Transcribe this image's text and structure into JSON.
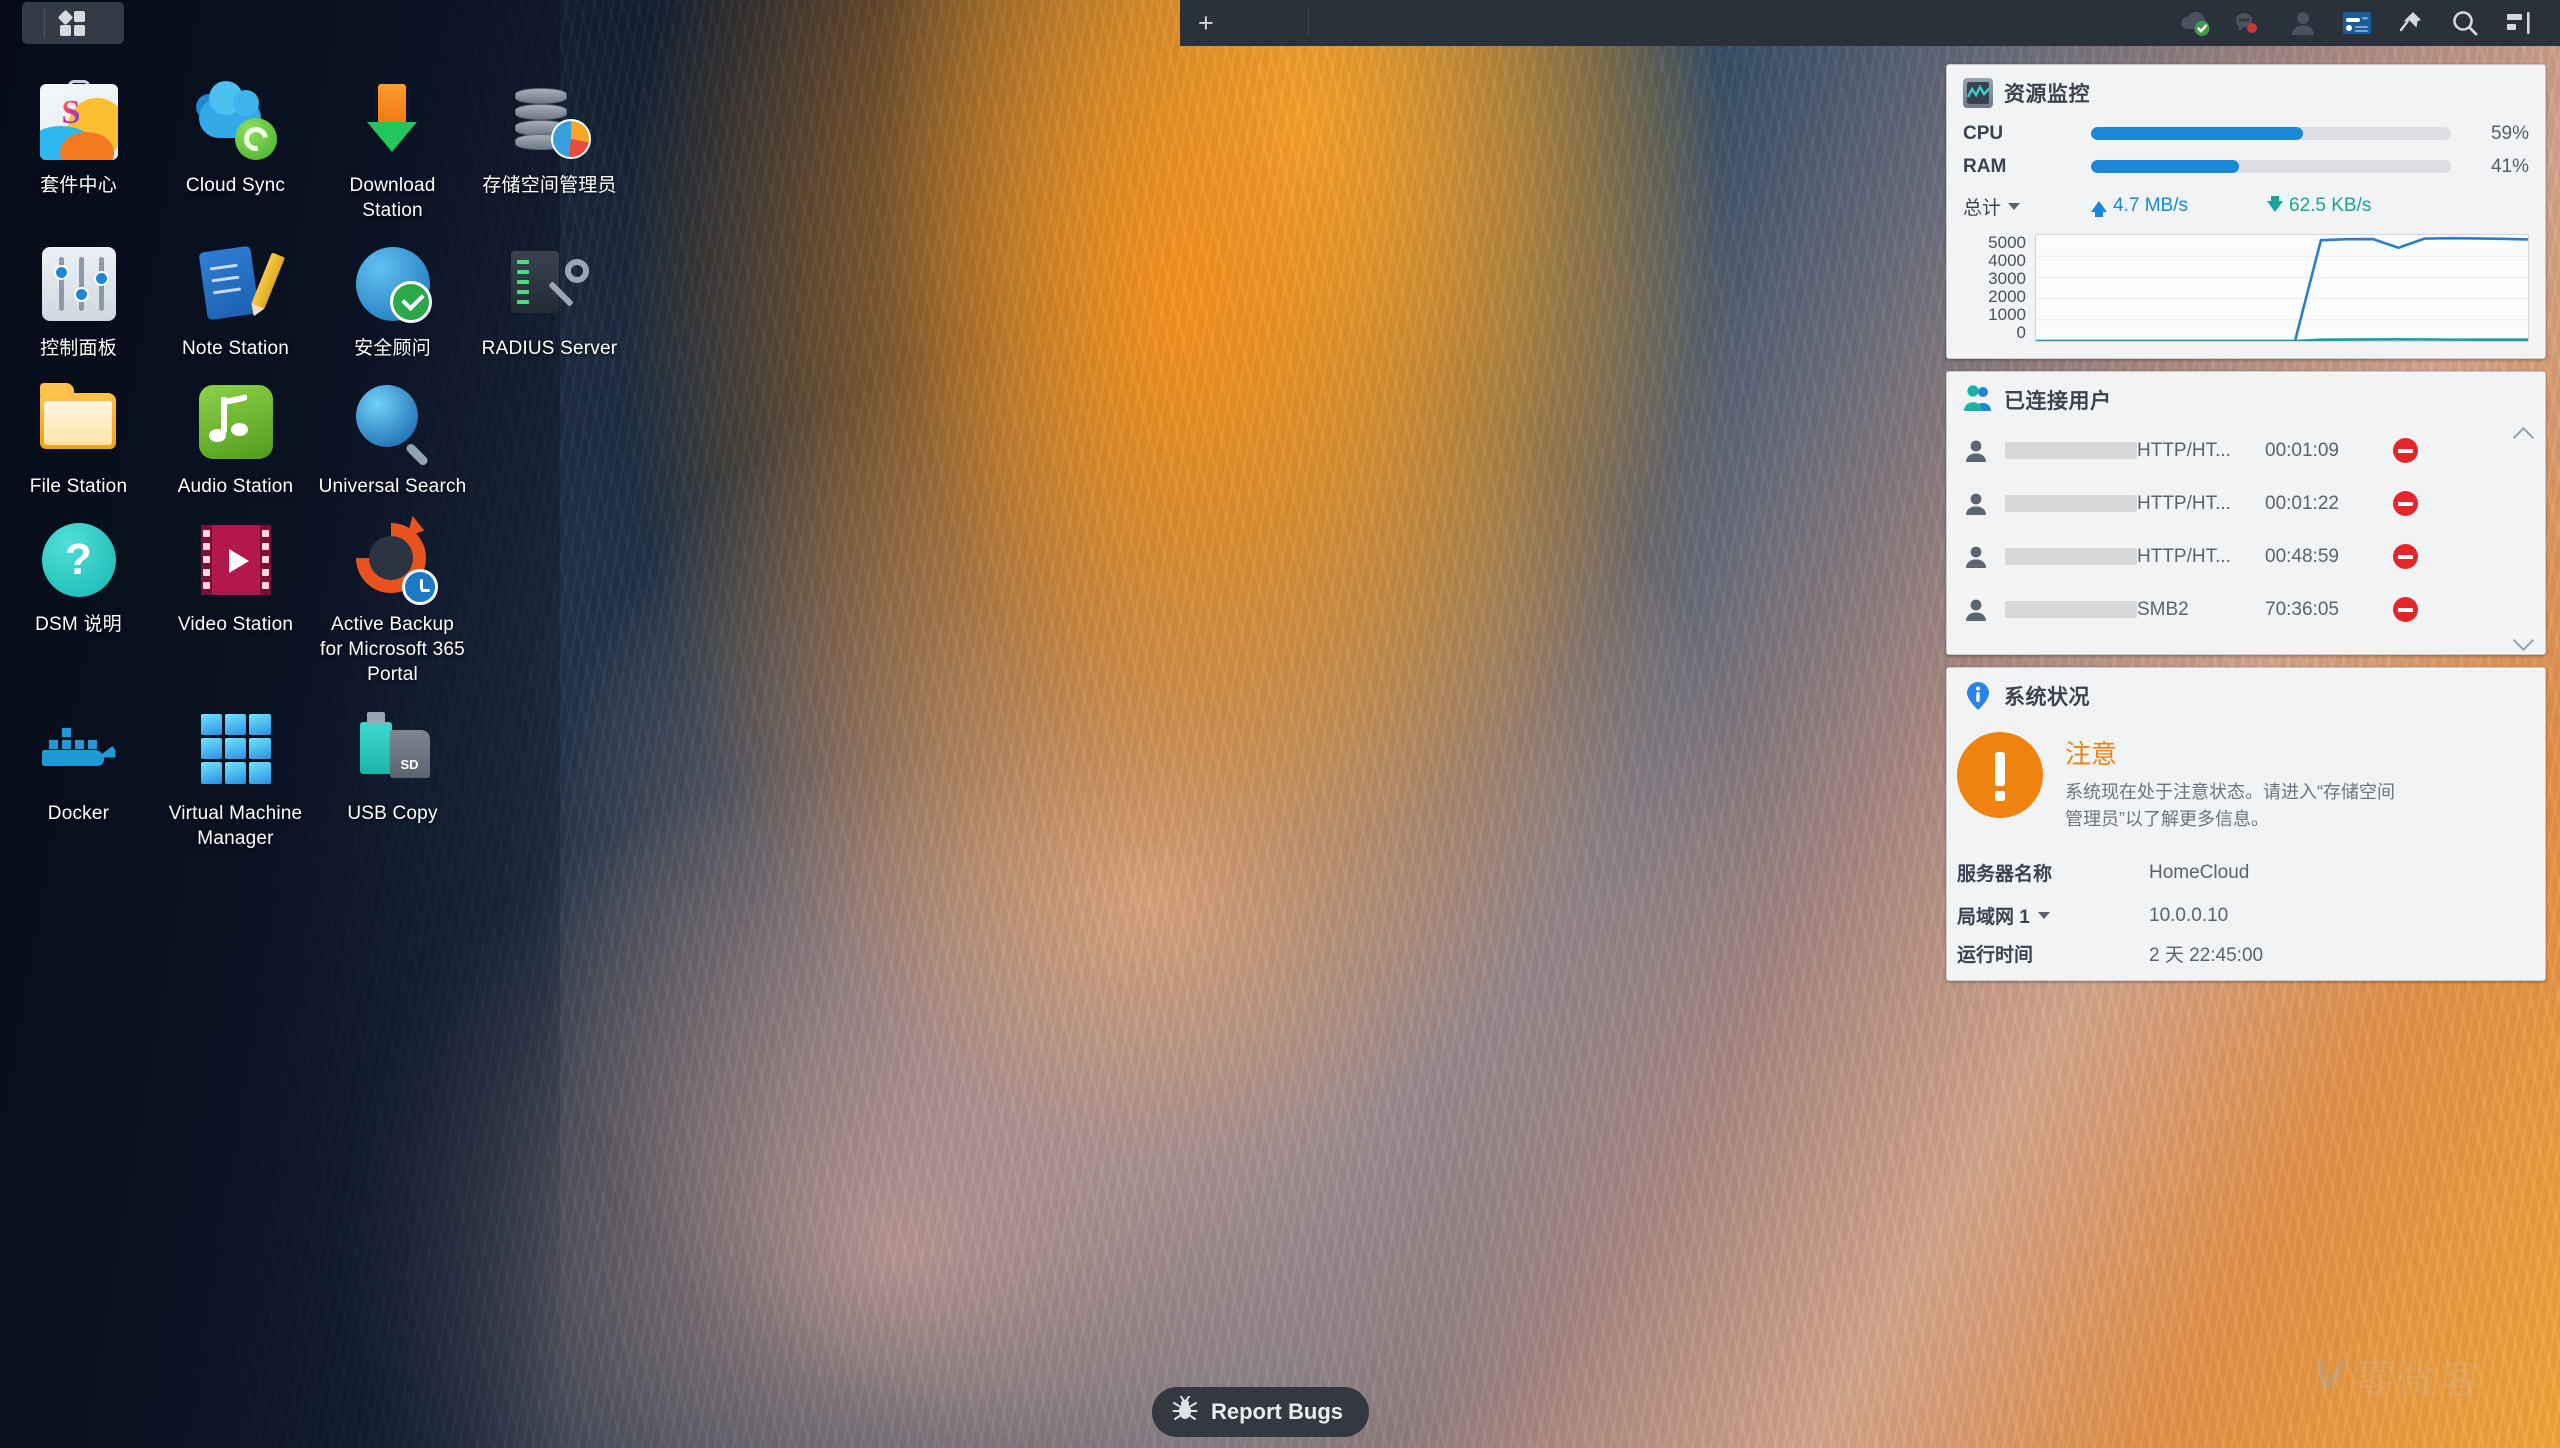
{
  "taskbar": {
    "main_menu_label": "主选单",
    "add_widget_label": "+",
    "icons": [
      {
        "name": "cloud-status-icon",
        "label": "云端状态"
      },
      {
        "name": "notifications-icon",
        "label": "通知"
      },
      {
        "name": "user-account-icon",
        "label": "个人设置"
      },
      {
        "name": "widgets-icon",
        "label": "小工具"
      },
      {
        "name": "pin-icon",
        "label": "钉选"
      },
      {
        "name": "search-icon",
        "label": "搜索"
      },
      {
        "name": "show-desktop-icon",
        "label": "显示桌面"
      }
    ]
  },
  "desktop": {
    "rows": [
      [
        {
          "label": "套件中心",
          "icon": "package-center-icon"
        },
        {
          "label": "Cloud Sync",
          "icon": "cloud-sync-icon"
        },
        {
          "label": "Download Station",
          "icon": "download-station-icon"
        },
        {
          "label": "存储空间管理员",
          "icon": "storage-manager-icon"
        }
      ],
      [
        {
          "label": "控制面板",
          "icon": "control-panel-icon"
        },
        {
          "label": "Note Station",
          "icon": "note-station-icon"
        },
        {
          "label": "安全顾问",
          "icon": "security-advisor-icon"
        },
        {
          "label": "RADIUS Server",
          "icon": "radius-server-icon"
        }
      ],
      [
        {
          "label": "File Station",
          "icon": "file-station-icon"
        },
        {
          "label": "Audio Station",
          "icon": "audio-station-icon"
        },
        {
          "label": "Universal Search",
          "icon": "universal-search-icon"
        },
        {
          "label": "",
          "icon": "none"
        }
      ],
      [
        {
          "label": "DSM 说明",
          "icon": "dsm-help-icon"
        },
        {
          "label": "Video Station",
          "icon": "video-station-icon"
        },
        {
          "label": "Active Backup for Microsoft 365 Portal",
          "icon": "active-backup-m365-icon"
        },
        {
          "label": "",
          "icon": "none"
        }
      ],
      [
        {
          "label": "Docker",
          "icon": "docker-icon"
        },
        {
          "label": "Virtual Machine Manager",
          "icon": "vmm-icon"
        },
        {
          "label": "USB Copy",
          "icon": "usb-copy-icon"
        },
        {
          "label": "",
          "icon": "none"
        }
      ]
    ]
  },
  "report_bugs": {
    "label": "Report Bugs",
    "icon": "bug-icon"
  },
  "resource_monitor": {
    "title": "资源监控",
    "cpu": {
      "label": "CPU",
      "value": "59%",
      "percent": 59
    },
    "ram": {
      "label": "RAM",
      "value": "41%",
      "percent": 41
    },
    "network_scope": "总计",
    "upload": "4.7 MB/s",
    "download": "62.5 KB/s"
  },
  "connected_users": {
    "title": "已连接用户",
    "rows": [
      {
        "user": "",
        "protocol": "HTTP/HT...",
        "duration": "00:01:09",
        "action": "disconnect"
      },
      {
        "user": "",
        "protocol": "HTTP/HT...",
        "duration": "00:01:22",
        "action": "disconnect"
      },
      {
        "user": "",
        "protocol": "HTTP/HT...",
        "duration": "00:48:59",
        "action": "disconnect"
      },
      {
        "user": "",
        "protocol": "SMB2",
        "duration": "70:36:05",
        "action": "disconnect"
      }
    ]
  },
  "system_health": {
    "title": "系统状况",
    "status_heading": "注意",
    "status_desc": "系统现在处于注意状态。请进入“存储空间管理员”以了解更多信息。",
    "info": [
      {
        "label": "服务器名称",
        "value": "HomeCloud"
      },
      {
        "label": "局域网 1",
        "value": "10.0.0.10",
        "has_caret": true
      },
      {
        "label": "运行时间",
        "value": "2 天 22:45:00"
      }
    ]
  },
  "watermark": {
    "logo": "V",
    "text": "零微客"
  },
  "colors": {
    "accent_blue": "#1a87d9",
    "teal": "#17a398",
    "warn_orange": "#f0820f",
    "danger_red": "#e4262b",
    "panel_bg": "#f2f3f5"
  },
  "chart_data": {
    "type": "line",
    "title": "网络流量",
    "ylabel": "",
    "xlabel": "",
    "ylim": [
      0,
      5000
    ],
    "yticks": [
      5000,
      4000,
      3000,
      2000,
      1000,
      0
    ],
    "grid": true,
    "legend": "none",
    "x": [
      0,
      1,
      2,
      3,
      4,
      5,
      6,
      7,
      8,
      9,
      10,
      11,
      12,
      13,
      14,
      15,
      16,
      17,
      18,
      19
    ],
    "series": [
      {
        "name": "上传",
        "color": "#2b7fc9",
        "values": [
          0,
          0,
          0,
          0,
          0,
          0,
          0,
          0,
          0,
          0,
          0,
          4750,
          4800,
          4810,
          4400,
          4830,
          4850,
          4840,
          4820,
          4790
        ]
      },
      {
        "name": "下载",
        "color": "#17a398",
        "values": [
          0,
          0,
          0,
          0,
          0,
          0,
          0,
          0,
          0,
          0,
          0,
          62,
          70,
          75,
          78,
          72,
          66,
          62,
          60,
          62
        ]
      }
    ]
  }
}
